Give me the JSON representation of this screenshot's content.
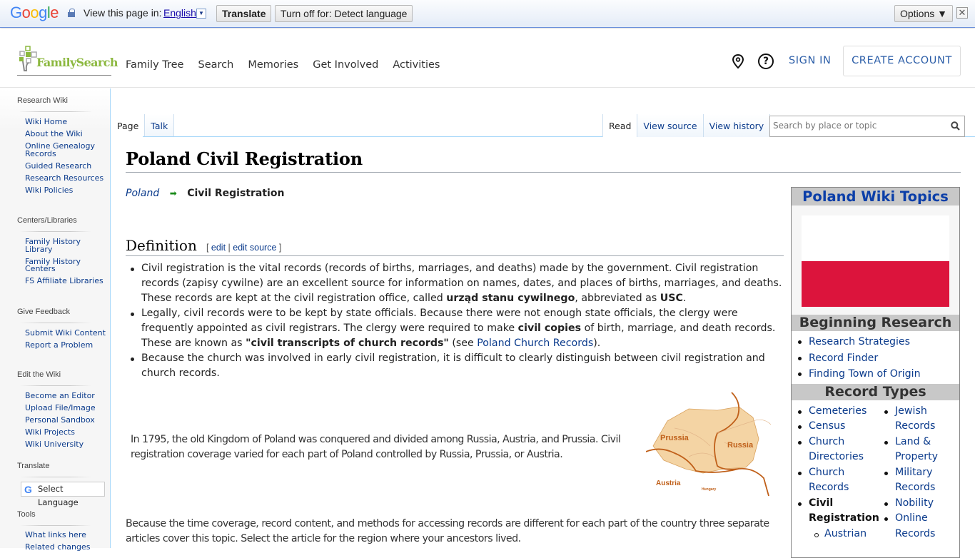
{
  "translate_bar": {
    "logo_letters": [
      "G",
      "o",
      "o",
      "g",
      "l",
      "e"
    ],
    "view_label": "View this page in:",
    "language": "English",
    "dropdown_glyph": "▼",
    "translate_button": "Translate",
    "turn_off_button": "Turn off for: Detect language",
    "options_button": "Options ▼",
    "close_glyph": "✕"
  },
  "header": {
    "logo_text": "FamilySearch",
    "nav": [
      "Family Tree",
      "Search",
      "Memories",
      "Get Involved",
      "Activities"
    ],
    "sign_in": "SIGN IN",
    "create_account": "CREATE ACCOUNT",
    "help_glyph": "?"
  },
  "sidebar": {
    "sections": [
      {
        "heading": "Research Wiki",
        "items": [
          "Wiki Home",
          "About the Wiki",
          "Online Genealogy Records",
          "Guided Research",
          "Research Resources",
          "Wiki Policies"
        ]
      },
      {
        "heading": "Centers/Libraries",
        "items": [
          "Family History Library",
          "Family History Centers",
          "FS Affiliate Libraries"
        ]
      },
      {
        "heading": "Give Feedback",
        "items": [
          "Submit Wiki Content",
          "Report a Problem"
        ]
      },
      {
        "heading": "Edit the Wiki",
        "items": [
          "Become an Editor",
          "Upload File/Image",
          "Personal Sandbox",
          "Wiki Projects",
          "Wiki University"
        ]
      },
      {
        "heading": "Translate",
        "items": []
      },
      {
        "heading": "Tools",
        "items": [
          "What links here",
          "Related changes"
        ]
      }
    ],
    "select_language": "Select Language"
  },
  "tabs": {
    "left": [
      "Page",
      "Talk"
    ],
    "right": [
      "Read",
      "View source",
      "View history"
    ],
    "search_placeholder": "Search by place or topic"
  },
  "content": {
    "title": "Poland Civil Registration",
    "breadcrumb": {
      "parent": "Poland",
      "current": "Civil Registration"
    },
    "section": {
      "heading": "Definition",
      "edit": "edit",
      "edit_source": "edit source"
    },
    "bullets": [
      {
        "t1": "Civil registration is the vital records (records of births, marriages, and deaths) made by the government. Civil registration records (zapisy cywilne) are an excellent source for information on names, dates, and places of births, marriages, and deaths. These records are kept at the civil registration office, called ",
        "b1": "urząd stanu cywilnego",
        "t2": ", abbreviated as ",
        "b2": "USC",
        "t3": "."
      },
      {
        "t1": "Legally, civil records were to be kept by state officials. Because there were not enough state officials, the clergy were frequently appointed as civil registrars. The clergy were required to make ",
        "b1": "civil copies",
        "t2": " of birth, marriage, and death records. These are known as ",
        "b2": "\"civil transcripts of church records\"",
        "t3": " (see ",
        "link": "Poland Church Records",
        "t4": ")."
      },
      {
        "t1": "Because the church was involved in early civil registration, it is difficult to clearly distinguish between civil registration and church records."
      }
    ],
    "paragraph1": "In 1795, the old Kingdom of Poland was conquered and divided among Russia, Austria, and Prussia. Civil registration coverage varied for each part of Poland controlled by Russia, Prussia, or Austria.",
    "paragraph2": "Because the time coverage, record content, and methods for accessing records are different for each part of the country three separate articles cover this topic. Select the article for the region where your ancestors lived.",
    "map_labels": {
      "prussia": "Prussia",
      "russia": "Russia",
      "austria": "Austria",
      "hungary": "Hungary"
    }
  },
  "infobox": {
    "title": "Poland Wiki Topics",
    "flag_colors": {
      "top": "#ffffff",
      "bottom": "#dc143c"
    },
    "beginning_heading": "Beginning Research",
    "beginning_items": [
      "Research Strategies",
      "Record Finder",
      "Finding Town of Origin"
    ],
    "record_types_heading": "Record Types",
    "col1": [
      "Cemeteries",
      "Census",
      "Church Directories",
      "Church Records"
    ],
    "col1_current": "Civil Registration",
    "col1_sub": [
      "Austrian"
    ],
    "col2": [
      "Jewish Records",
      "Land & Property",
      "Military Records",
      "Nobility",
      "Online Records"
    ]
  }
}
